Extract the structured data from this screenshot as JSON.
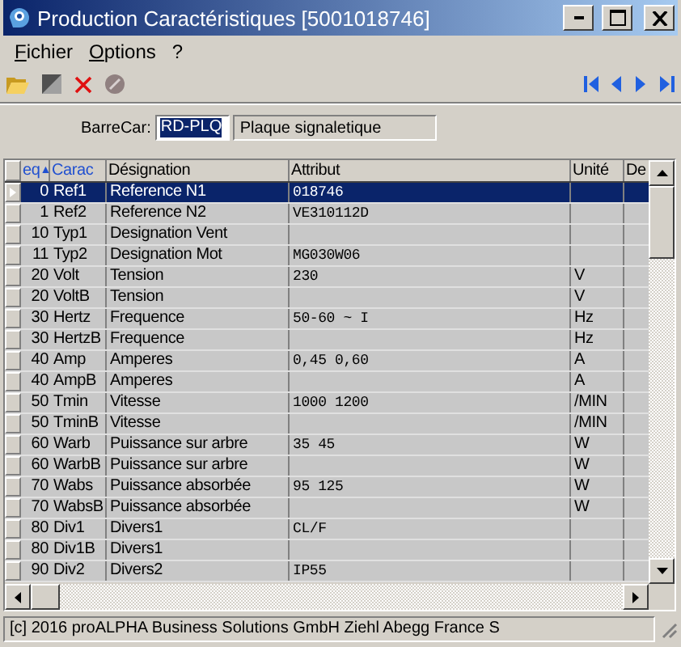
{
  "window": {
    "title": "Production Caractéristiques  [5001018746]"
  },
  "menu": [
    {
      "label": "Fichier"
    },
    {
      "label": "Options"
    },
    {
      "label": "?"
    }
  ],
  "barrecar": {
    "label": "BarreCar:",
    "code": "RD-PLQ",
    "description": "Plaque signaletique"
  },
  "table": {
    "columns": [
      {
        "label": "eq",
        "sorted": true,
        "sort_mark": "▲"
      },
      {
        "label": "Carac",
        "sorted": true
      },
      {
        "label": "Désignation",
        "sorted": false
      },
      {
        "label": "Attribut",
        "sorted": false
      },
      {
        "label": "Unité",
        "sorted": false
      },
      {
        "label": "De",
        "sorted": false
      }
    ],
    "rows": [
      {
        "seq": "0",
        "carac": "Ref1",
        "designation": "Reference N1",
        "attribut": "018746",
        "unite": "",
        "selected": true
      },
      {
        "seq": "1",
        "carac": "Ref2",
        "designation": "Reference N2",
        "attribut": "VE310112D",
        "unite": "",
        "selected": false
      },
      {
        "seq": "10",
        "carac": "Typ1",
        "designation": "Designation Vent",
        "attribut": "",
        "unite": "",
        "selected": false
      },
      {
        "seq": "11",
        "carac": "Typ2",
        "designation": "Designation Mot",
        "attribut": "MG030W06",
        "unite": "",
        "selected": false
      },
      {
        "seq": "20",
        "carac": "Volt",
        "designation": "Tension",
        "attribut": "230",
        "unite": "V",
        "selected": false
      },
      {
        "seq": "20",
        "carac": "VoltB",
        "designation": "Tension",
        "attribut": "",
        "unite": "V",
        "selected": false
      },
      {
        "seq": "30",
        "carac": "Hertz",
        "designation": "Frequence",
        "attribut": "50-60 ~ I",
        "unite": "Hz",
        "selected": false
      },
      {
        "seq": "30",
        "carac": "HertzB",
        "designation": "Frequence",
        "attribut": "",
        "unite": "Hz",
        "selected": false
      },
      {
        "seq": "40",
        "carac": "Amp",
        "designation": "Amperes",
        "attribut": "0,45 0,60",
        "unite": "A",
        "selected": false
      },
      {
        "seq": "40",
        "carac": "AmpB",
        "designation": "Amperes",
        "attribut": "",
        "unite": "A",
        "selected": false
      },
      {
        "seq": "50",
        "carac": "Tmin",
        "designation": "Vitesse",
        "attribut": "1000 1200",
        "unite": "/MIN",
        "selected": false
      },
      {
        "seq": "50",
        "carac": "TminB",
        "designation": "Vitesse",
        "attribut": "",
        "unite": "/MIN",
        "selected": false
      },
      {
        "seq": "60",
        "carac": "Warb",
        "designation": "Puissance sur arbre",
        "attribut": "35 45",
        "unite": "W",
        "selected": false
      },
      {
        "seq": "60",
        "carac": "WarbB",
        "designation": "Puissance sur arbre",
        "attribut": "",
        "unite": "W",
        "selected": false
      },
      {
        "seq": "70",
        "carac": "Wabs",
        "designation": "Puissance absorbée",
        "attribut": "95 125",
        "unite": "W",
        "selected": false
      },
      {
        "seq": "70",
        "carac": "WabsB",
        "designation": "Puissance absorbée",
        "attribut": "",
        "unite": "W",
        "selected": false
      },
      {
        "seq": "80",
        "carac": "Div1",
        "designation": "Divers1",
        "attribut": "CL/F",
        "unite": "",
        "selected": false
      },
      {
        "seq": "80",
        "carac": "Div1B",
        "designation": "Divers1",
        "attribut": "",
        "unite": "",
        "selected": false
      },
      {
        "seq": "90",
        "carac": "Div2",
        "designation": "Divers2",
        "attribut": "IP55",
        "unite": "",
        "selected": false
      }
    ]
  },
  "status_bar": {
    "text": "[c] 2016 proALPHA Business Solutions GmbH  Ziehl Abegg France S"
  }
}
